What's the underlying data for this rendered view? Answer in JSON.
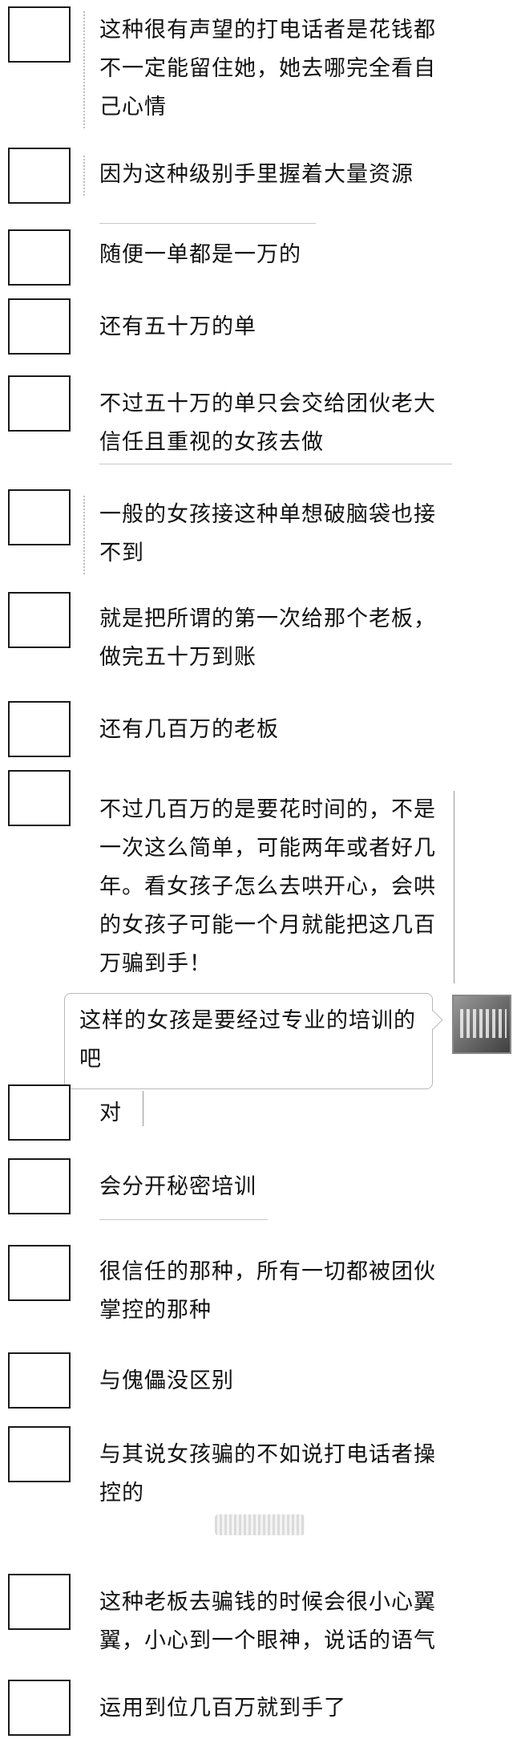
{
  "messages": [
    {
      "side": "left",
      "text": "这种很有声望的打电话者是花钱都不一定能留住她，她去哪完全看自己心情"
    },
    {
      "side": "left",
      "text": "因为这种级别手里握着大量资源"
    },
    {
      "side": "left",
      "text": "随便一单都是一万的"
    },
    {
      "side": "left",
      "text": "还有五十万的单"
    },
    {
      "side": "left",
      "text": "不过五十万的单只会交给团伙老大信任且重视的女孩去做"
    },
    {
      "side": "left",
      "text": "一般的女孩接这种单想破脑袋也接不到"
    },
    {
      "side": "left",
      "text": "就是把所谓的第一次给那个老板，做完五十万到账"
    },
    {
      "side": "left",
      "text": "还有几百万的老板"
    },
    {
      "side": "left",
      "text": "不过几百万的是要花时间的，不是一次这么简单，可能两年或者好几年。看女孩子怎么去哄开心，会哄的女孩子可能一个月就能把这几百万骗到手！"
    },
    {
      "side": "right",
      "text": "这样的女孩是要经过专业的培训的吧"
    },
    {
      "side": "left",
      "text": "对"
    },
    {
      "side": "left",
      "text": "会分开秘密培训"
    },
    {
      "side": "left",
      "text": "很信任的那种，所有一切都被团伙掌控的那种"
    },
    {
      "side": "left",
      "text": "与傀儡没区别"
    },
    {
      "side": "left",
      "text": "与其说女孩骗的不如说打电话者操控的"
    },
    {
      "side": "left",
      "text": "这种老板去骗钱的时候会很小心翼翼，小心到一个眼神，说话的语气"
    },
    {
      "side": "left",
      "text": "运用到位几百万就到手了"
    }
  ]
}
